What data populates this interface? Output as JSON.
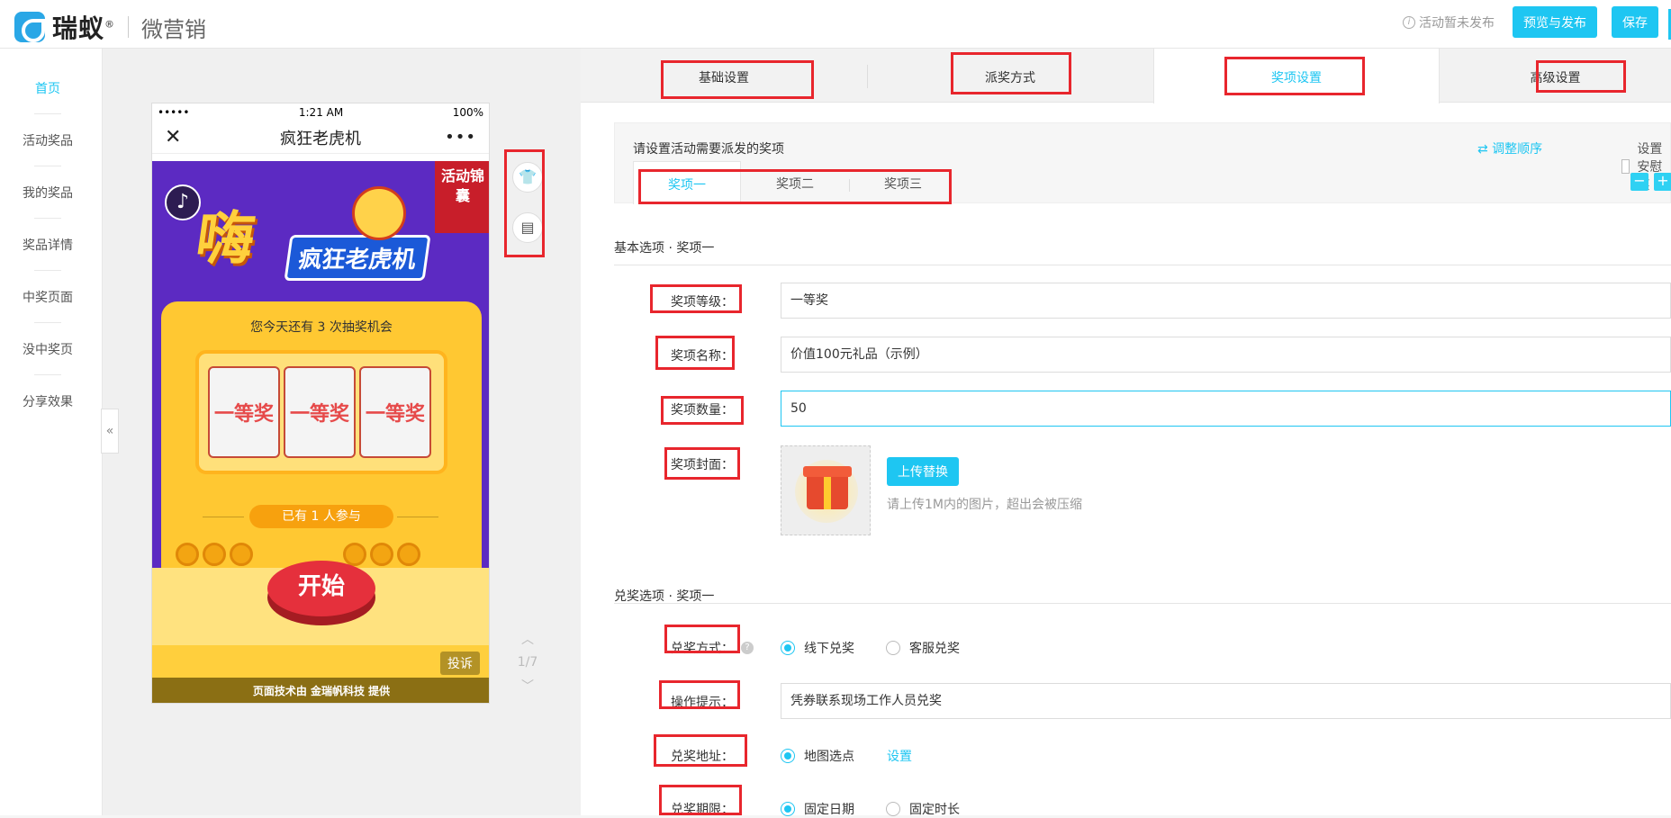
{
  "header": {
    "brand": "瑞蚁",
    "reg": "®",
    "sub_brand": "微营销",
    "status": "活动暂未发布",
    "preview_publish": "预览与发布",
    "save": "保存"
  },
  "leftnav": {
    "items": [
      "首页",
      "活动奖品",
      "我的奖品",
      "奖品详情",
      "中奖页面",
      "没中奖页",
      "分享效果"
    ]
  },
  "phone": {
    "carrier": "•••••",
    "time": "1:21 AM",
    "battery": "100%",
    "page_title": "疯狂老虎机",
    "banner_big": "嗨",
    "banner_sub": "疯狂老虎机",
    "ribbon": "活动锦囊",
    "chances": "您今天还有 3 次抽奖机会",
    "reels": [
      "一等奖",
      "一等奖",
      "一等奖"
    ],
    "joined": "已有 1 人参与",
    "start": "开始",
    "report": "投诉",
    "footer": "页面技术由 金瑞帆科技 提供",
    "pager": "1/7"
  },
  "tabs": [
    "基础设置",
    "派奖方式",
    "奖项设置",
    "高级设置"
  ],
  "prize_panel": {
    "tip": "请设置活动需要派发的奖项",
    "reorder": "⇄ 调整顺序",
    "consolation": "设置安慰奖",
    "subtabs": [
      "奖项一",
      "奖项二",
      "奖项三"
    ],
    "minus": "−",
    "plus": "+"
  },
  "basic": {
    "title": "基本选项 · 奖项一",
    "level_label": "奖项等级：",
    "level_value": "一等奖",
    "name_label": "奖项名称：",
    "name_value": "价值100元礼品（示例）",
    "qty_label": "奖项数量：",
    "qty_value": "50",
    "cover_label": "奖项封面：",
    "upload": "上传替换",
    "upload_hint": "请上传1M内的图片，超出会被压缩"
  },
  "redeem": {
    "title": "兑奖选项 · 奖项一",
    "method_label": "兑奖方式：",
    "method_options": [
      "线下兑奖",
      "客服兑奖"
    ],
    "tip_label": "操作提示：",
    "tip_value": "凭券联系现场工作人员兑奖",
    "address_label": "兑奖地址：",
    "address_option": "地图选点",
    "address_link": "设置",
    "period_label": "兑奖期限：",
    "period_options": [
      "固定日期",
      "固定时长"
    ]
  },
  "colors": {
    "accent": "#1ec6f2",
    "highlight": "#e8262d"
  }
}
